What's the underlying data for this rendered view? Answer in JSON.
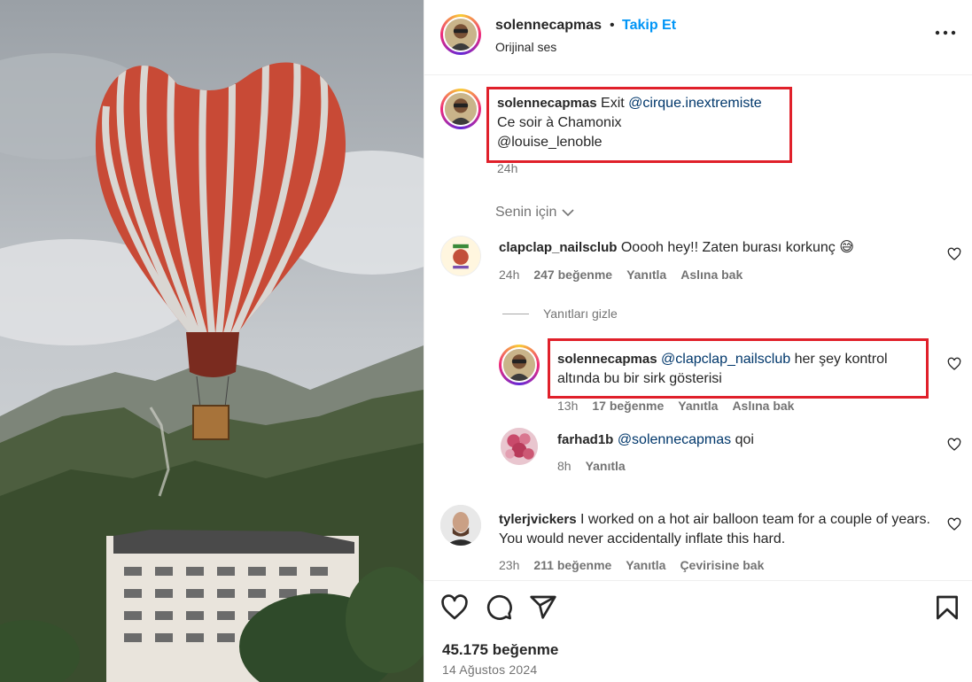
{
  "header": {
    "username": "solennecapmas",
    "dot": "•",
    "follow_label": "Takip Et",
    "audio_label": "Orijinal ses"
  },
  "caption": {
    "username": "solennecapmas",
    "text1": "Exit",
    "mention1": "@cirque.inextremiste",
    "line2": "Ce soir à Chamonix",
    "mention2": "@louise_lenoble",
    "time": "24h"
  },
  "for_you_label": "Senin için",
  "comments": [
    {
      "username": "clapclap_nailsclub",
      "text": "Ooooh hey!! Zaten burası korkunç 😅",
      "time": "24h",
      "likes": "247 beğenme",
      "reply_label": "Yanıtla",
      "see_original": "Aslına bak"
    },
    {
      "username": "tylerjvickers",
      "text": "I worked on a hot air balloon team for a couple of years. You would never accidentally inflate this hard.",
      "time": "23h",
      "likes": "211 beğenme",
      "reply_label": "Yanıtla",
      "see_translation": "Çevirisine bak"
    }
  ],
  "hide_replies_label": "Yanıtları gizle",
  "replies": [
    {
      "username": "solennecapmas",
      "mention": "@clapclap_nailsclub",
      "text": "her şey kontrol altında bu bir sirk gösterisi",
      "time": "13h",
      "likes": "17 beğenme",
      "reply_label": "Yanıtla",
      "see_original": "Aslına bak"
    },
    {
      "username": "farhad1b",
      "mention": "@solennecapmas",
      "text": "qoi",
      "time": "8h",
      "reply_label": "Yanıtla"
    }
  ],
  "footer": {
    "likes": "45.175 beğenme",
    "date": "14 Ağustos 2024"
  },
  "colors": {
    "follow_blue": "#0095f6",
    "mention_blue": "#00376b",
    "highlight_red": "#e0202a",
    "muted_gray": "#737373"
  },
  "icons": [
    "more-icon",
    "chevron-down-icon",
    "heart-icon",
    "comment-icon",
    "share-icon",
    "bookmark-icon"
  ]
}
